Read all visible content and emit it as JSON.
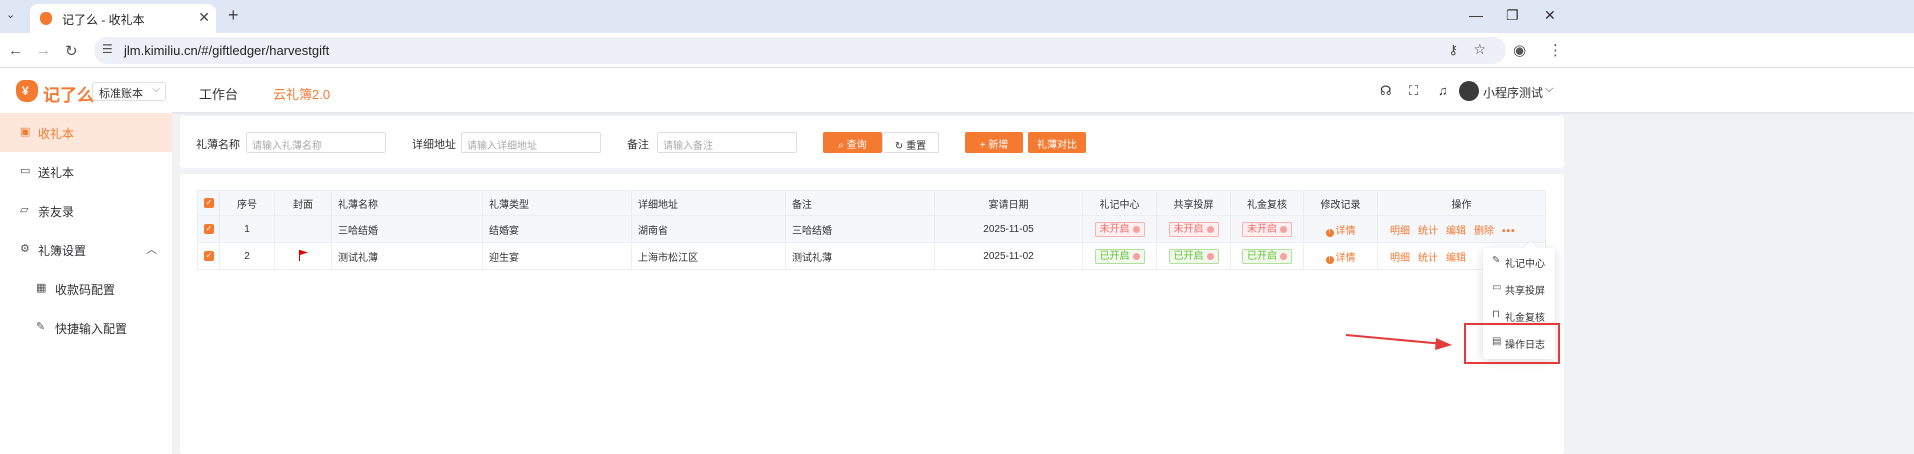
{
  "browser": {
    "tab_title": "记了么 - 收礼本",
    "tab_close": "✕",
    "new_tab": "+",
    "url": "jlm.kimiliu.cn/#/giftledger/harvestgift"
  },
  "header": {
    "logo_text": "记了么",
    "book_select": "标准账本",
    "nav": [
      "工作台",
      "云礼簿2.0"
    ],
    "username": "小程序测试"
  },
  "sidebar": {
    "items": [
      {
        "label": "收礼本",
        "icon": "book-icon"
      },
      {
        "label": "送礼本",
        "icon": "gift-icon"
      },
      {
        "label": "亲友录",
        "icon": "folder-icon"
      },
      {
        "label": "礼簿设置",
        "icon": "gear-icon"
      },
      {
        "label": "收款码配置",
        "icon": "qrcode-icon"
      },
      {
        "label": "快捷输入配置",
        "icon": "edit-icon"
      }
    ]
  },
  "search": {
    "fields": [
      {
        "label": "礼薄名称",
        "placeholder": "请输入礼薄名称"
      },
      {
        "label": "详细地址",
        "placeholder": "请输入详细地址"
      },
      {
        "label": "备注",
        "placeholder": "请输入备注"
      }
    ],
    "query_btn": "查询",
    "reset_btn": "重置",
    "add_btn": "新增",
    "compare_btn": "礼薄对比"
  },
  "table": {
    "columns": [
      "序号",
      "封面",
      "礼薄名称",
      "礼薄类型",
      "详细地址",
      "备注",
      "宴请日期",
      "礼记中心",
      "共享投屏",
      "礼金复核",
      "修改记录",
      "操作"
    ],
    "rows": [
      {
        "no": "1",
        "name": "三哈结婚",
        "type": "结婚宴",
        "address": "湖南省",
        "remark": "三哈结婚",
        "date": "2025-11-05",
        "center": "未开启",
        "share": "未开启",
        "review": "未开启",
        "log": "详情",
        "cover": ""
      },
      {
        "no": "2",
        "name": "测试礼薄",
        "type": "迎生宴",
        "address": "上海市松江区",
        "remark": "测试礼薄",
        "date": "2025-11-02",
        "center": "已开启",
        "share": "已开启",
        "review": "已开启",
        "log": "详情",
        "cover": "flag"
      }
    ],
    "actions": [
      "明细",
      "统计",
      "编辑",
      "删除"
    ],
    "more": "•••"
  },
  "dropdown": {
    "items": [
      {
        "label": "礼记中心",
        "icon": "edit-icon"
      },
      {
        "label": "共享投屏",
        "icon": "monitor-icon"
      },
      {
        "label": "礼金复核",
        "icon": "lock-icon"
      },
      {
        "label": "操作日志",
        "icon": "document-icon"
      }
    ]
  },
  "colors": {
    "accent": "#f47a32",
    "highlight": "#e23b3b"
  }
}
